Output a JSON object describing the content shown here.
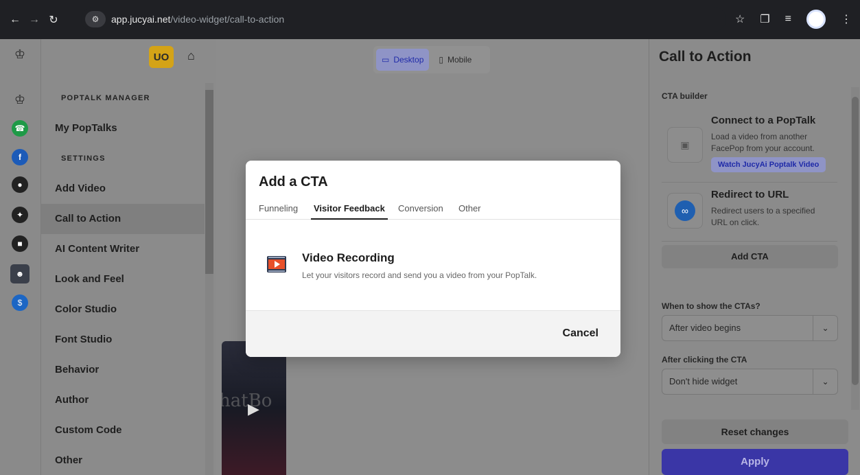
{
  "browser": {
    "url_host": "app.jucyai.net",
    "url_path": "/video-widget/call-to-action"
  },
  "sidebar": {
    "user_initials": "UO",
    "sections": [
      {
        "label": "POPTALK MANAGER",
        "items": [
          "My PopTalks"
        ]
      },
      {
        "label": "SETTINGS",
        "items": [
          "Add Video",
          "Call to Action",
          "AI Content Writer",
          "Look and Feel",
          "Color Studio",
          "Font Studio",
          "Behavior",
          "Author",
          "Custom Code",
          "Other"
        ]
      }
    ],
    "active_item": "Call to Action"
  },
  "canvas": {
    "desktop_label": "Desktop",
    "mobile_label": "Mobile",
    "active_view": "Desktop",
    "thumb_text": "hatBo"
  },
  "right_panel": {
    "title": "Call to Action",
    "builder_label": "CTA builder",
    "cards": [
      {
        "title": "Connect to a PopTalk",
        "description": "Load a video from another FacePop from your account.",
        "link": "Watch JucyAi Poptalk Video"
      },
      {
        "title": "Redirect to URL",
        "description": "Redirect users to a specified URL on click."
      }
    ],
    "add_cta": "Add CTA",
    "when_label": "When to show the CTAs?",
    "when_value": "After video begins",
    "after_label": "After clicking the CTA",
    "after_value": "Don't hide widget",
    "reset": "Reset changes",
    "apply": "Apply"
  },
  "modal": {
    "title": "Add a CTA",
    "tabs": [
      "Funneling",
      "Visitor Feedback",
      "Conversion",
      "Other"
    ],
    "active_tab": "Visitor Feedback",
    "option": {
      "title": "Video Recording",
      "description": "Let your visitors record and send you a video from your PopTalk."
    },
    "cancel": "Cancel"
  },
  "colors": {
    "primary": "#3a36a6",
    "accent_badge": "#d4a317",
    "link_bg": "#8f94c6"
  }
}
